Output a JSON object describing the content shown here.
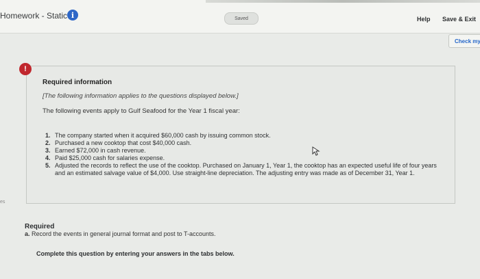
{
  "header": {
    "assignment_title": "Homework - Static",
    "saved_label": "Saved",
    "help_label": "Help",
    "save_exit_label": "Save & Exit",
    "check_my_label": "Check my"
  },
  "info": {
    "title": "Required information",
    "note": "[The following information applies to the questions displayed below.]",
    "intro": "The following events apply to Gulf Seafood for the Year 1 fiscal year:",
    "events": [
      {
        "num": "1.",
        "text": "The company started when it acquired $60,000 cash by issuing common stock."
      },
      {
        "num": "2.",
        "text": "Purchased a new cooktop that cost $40,000 cash."
      },
      {
        "num": "3.",
        "text": "Earned $72,000 in cash revenue."
      },
      {
        "num": "4.",
        "text": "Paid $25,000 cash for salaries expense."
      },
      {
        "num": "5.",
        "text": "Adjusted the records to reflect the use of the cooktop. Purchased on January 1, Year 1, the cooktop has an expected useful life of four years and an estimated salvage value of $4,000. Use straight-line depreciation. The adjusting entry was made as of December 31, Year 1."
      }
    ]
  },
  "required": {
    "heading": "Required",
    "item_letter": "a.",
    "item_text": "Record the events in general journal format and post to T-accounts."
  },
  "instructions": "Complete this question by entering your answers in the tabs below.",
  "edge_text": "es",
  "colors": {
    "accent_blue": "#2e67c7",
    "alert_red": "#c0272d",
    "link_blue": "#2466c9"
  }
}
